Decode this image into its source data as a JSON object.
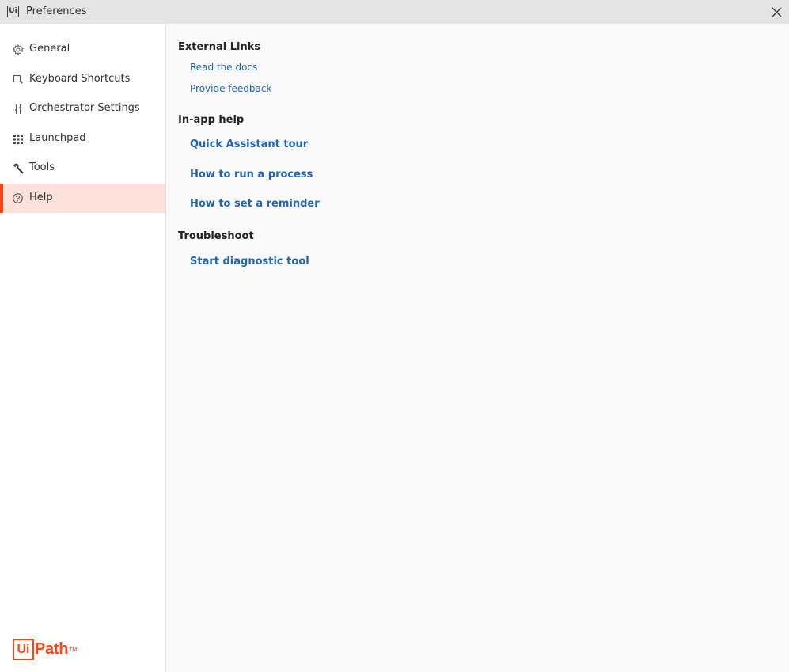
{
  "window": {
    "title": "Preferences",
    "app_icon_text": "Ui"
  },
  "sidebar": {
    "items": [
      {
        "label": "General",
        "icon": "gear-icon",
        "active": false
      },
      {
        "label": "Keyboard Shortcuts",
        "icon": "keyboard-shortcut-icon",
        "active": false
      },
      {
        "label": "Orchestrator Settings",
        "icon": "sliders-icon",
        "active": false
      },
      {
        "label": "Launchpad",
        "icon": "grid-icon",
        "active": false
      },
      {
        "label": "Tools",
        "icon": "wrench-icon",
        "active": false
      },
      {
        "label": "Help",
        "icon": "help-circle-icon",
        "active": true
      }
    ],
    "logo": {
      "box_text": "Ui",
      "text": "Path",
      "tm": "TM"
    }
  },
  "main": {
    "external_links": {
      "title": "External Links",
      "links": [
        "Read the docs",
        "Provide feedback"
      ]
    },
    "in_app_help": {
      "title": "In-app help",
      "links": [
        "Quick Assistant tour",
        "How to run a process",
        "How to set a reminder"
      ]
    },
    "troubleshoot": {
      "title": "Troubleshoot",
      "links": [
        "Start diagnostic tool"
      ]
    }
  },
  "colors": {
    "accent": "#fa4616",
    "link": "#1f63b4",
    "active_bg": "#fde2db"
  }
}
